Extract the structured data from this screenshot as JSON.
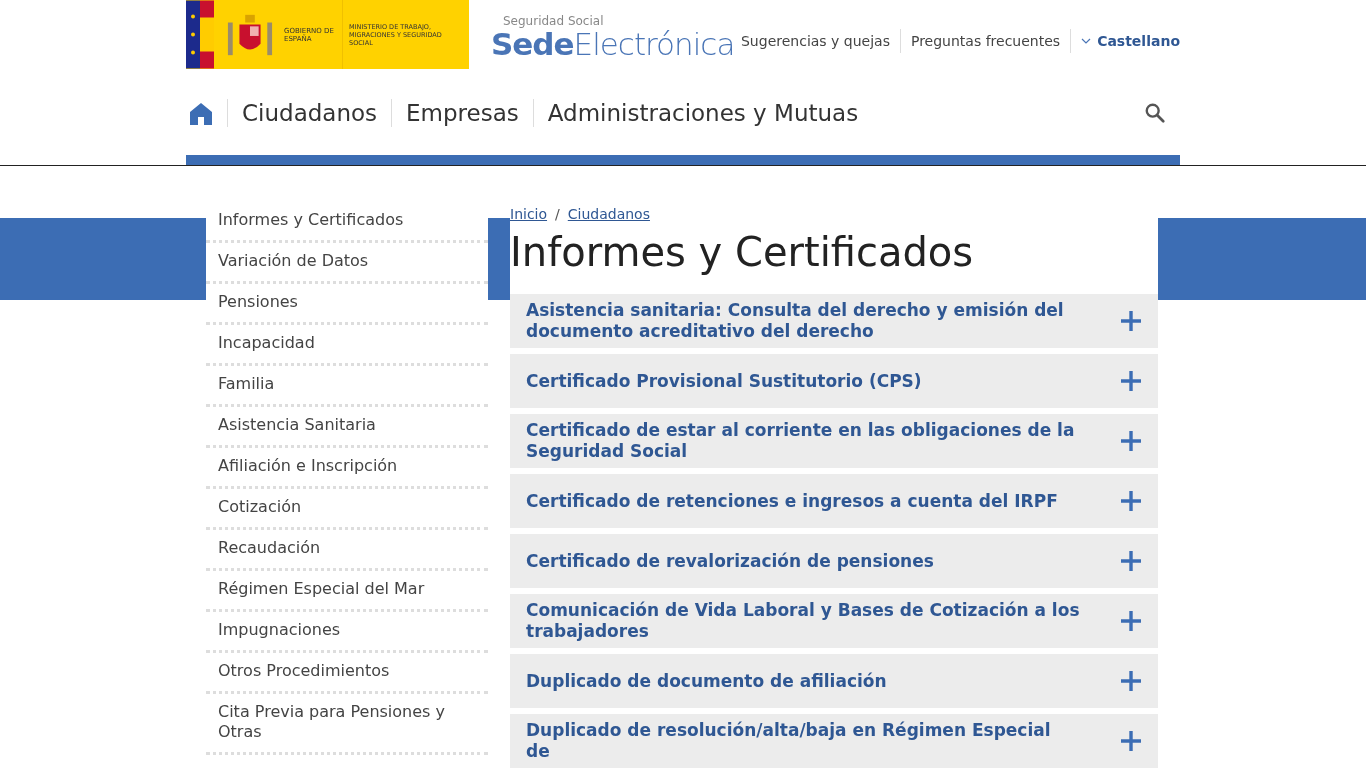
{
  "header": {
    "gov_logo": {
      "government": "GOBIERNO DE ESPAÑA",
      "ministry": "MINISTERIO DE TRABAJO, MIGRACIONES Y SEGURIDAD SOCIAL"
    },
    "site_logo": {
      "subtitle": "Seguridad Social",
      "title": "**Sede**Electrónica"
    },
    "links": [
      "Sugerencias y quejas",
      "Preguntas frecuentes"
    ],
    "language": "Castellano"
  },
  "nav": {
    "items": [
      "Ciudadanos",
      "Empresas",
      "Administraciones y Mutuas"
    ]
  },
  "sidebar": {
    "items": [
      "Informes y Certificados",
      "Variación de Datos",
      "Pensiones",
      "Incapacidad",
      "Familia",
      "Asistencia Sanitaria",
      "Afiliación e Inscripción",
      "Cotización",
      "Recaudación",
      "Régimen Especial del Mar",
      "Impugnaciones",
      "Otros Procedimientos",
      "Cita Previa para Pensiones y Otras"
    ]
  },
  "breadcrumb": [
    "Inicio",
    "Ciudadanos"
  ],
  "breadcrumb_separator": "/",
  "page_title": "Informes y Certificados",
  "accordion": [
    {
      "title": "Asistencia sanitaria: Consulta del derecho y emisión del documento acreditativo del derecho",
      "expanded": false
    },
    {
      "title": "Certificado Provisional Sustitutorio (CPS)",
      "expanded": false
    },
    {
      "title": "Certificado de estar al corriente en las obligaciones de la Seguridad Social",
      "expanded": false
    },
    {
      "title": "Certificado de retenciones e ingresos a cuenta del IRPF",
      "expanded": false
    },
    {
      "title": "Certificado de revalorización de pensiones",
      "expanded": false
    },
    {
      "title": "Comunicación de Vida Laboral y Bases de Cotización a los trabajadores",
      "expanded": false
    },
    {
      "title": "Duplicado de documento de afiliación",
      "expanded": false
    },
    {
      "title": "Duplicado de resolución/alta/baja en Régimen Especial de",
      "expanded": false
    }
  ]
}
